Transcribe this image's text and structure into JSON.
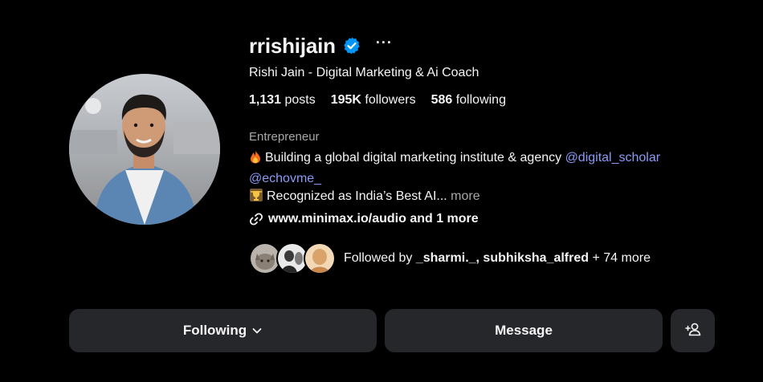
{
  "profile": {
    "username": "rrishijain",
    "full_name": "Rishi Jain - Digital Marketing & Ai Coach",
    "verified_icon": "verified-badge-icon",
    "more_options_label": "···"
  },
  "stats": {
    "posts_count": "1,131",
    "posts_label": " posts",
    "followers_count": "195K",
    "followers_label": " followers",
    "following_count": "586",
    "following_label": " following"
  },
  "bio": {
    "category": "Entrepreneur",
    "line1_text": "Building a global digital marketing institute & agency ",
    "line1_mention1": "@digital_scholar",
    "line2_mention": "@echovme_",
    "line3_text": "Recognized as India’s Best AI... ",
    "more_label": "more",
    "link_text": "www.minimax.io/audio and 1 more"
  },
  "followed_by": {
    "prefix": "Followed by ",
    "names": "_sharmi._, subhiksha_alfred",
    "suffix": " + 74 more"
  },
  "actions": {
    "following_label": "Following",
    "message_label": "Message",
    "suggest_icon": "add-person-icon"
  },
  "colors": {
    "background": "#000000",
    "button_bg": "#26272b",
    "mention": "#8b9bf5",
    "verified": "#0095f6",
    "muted": "#a8a8a8"
  }
}
